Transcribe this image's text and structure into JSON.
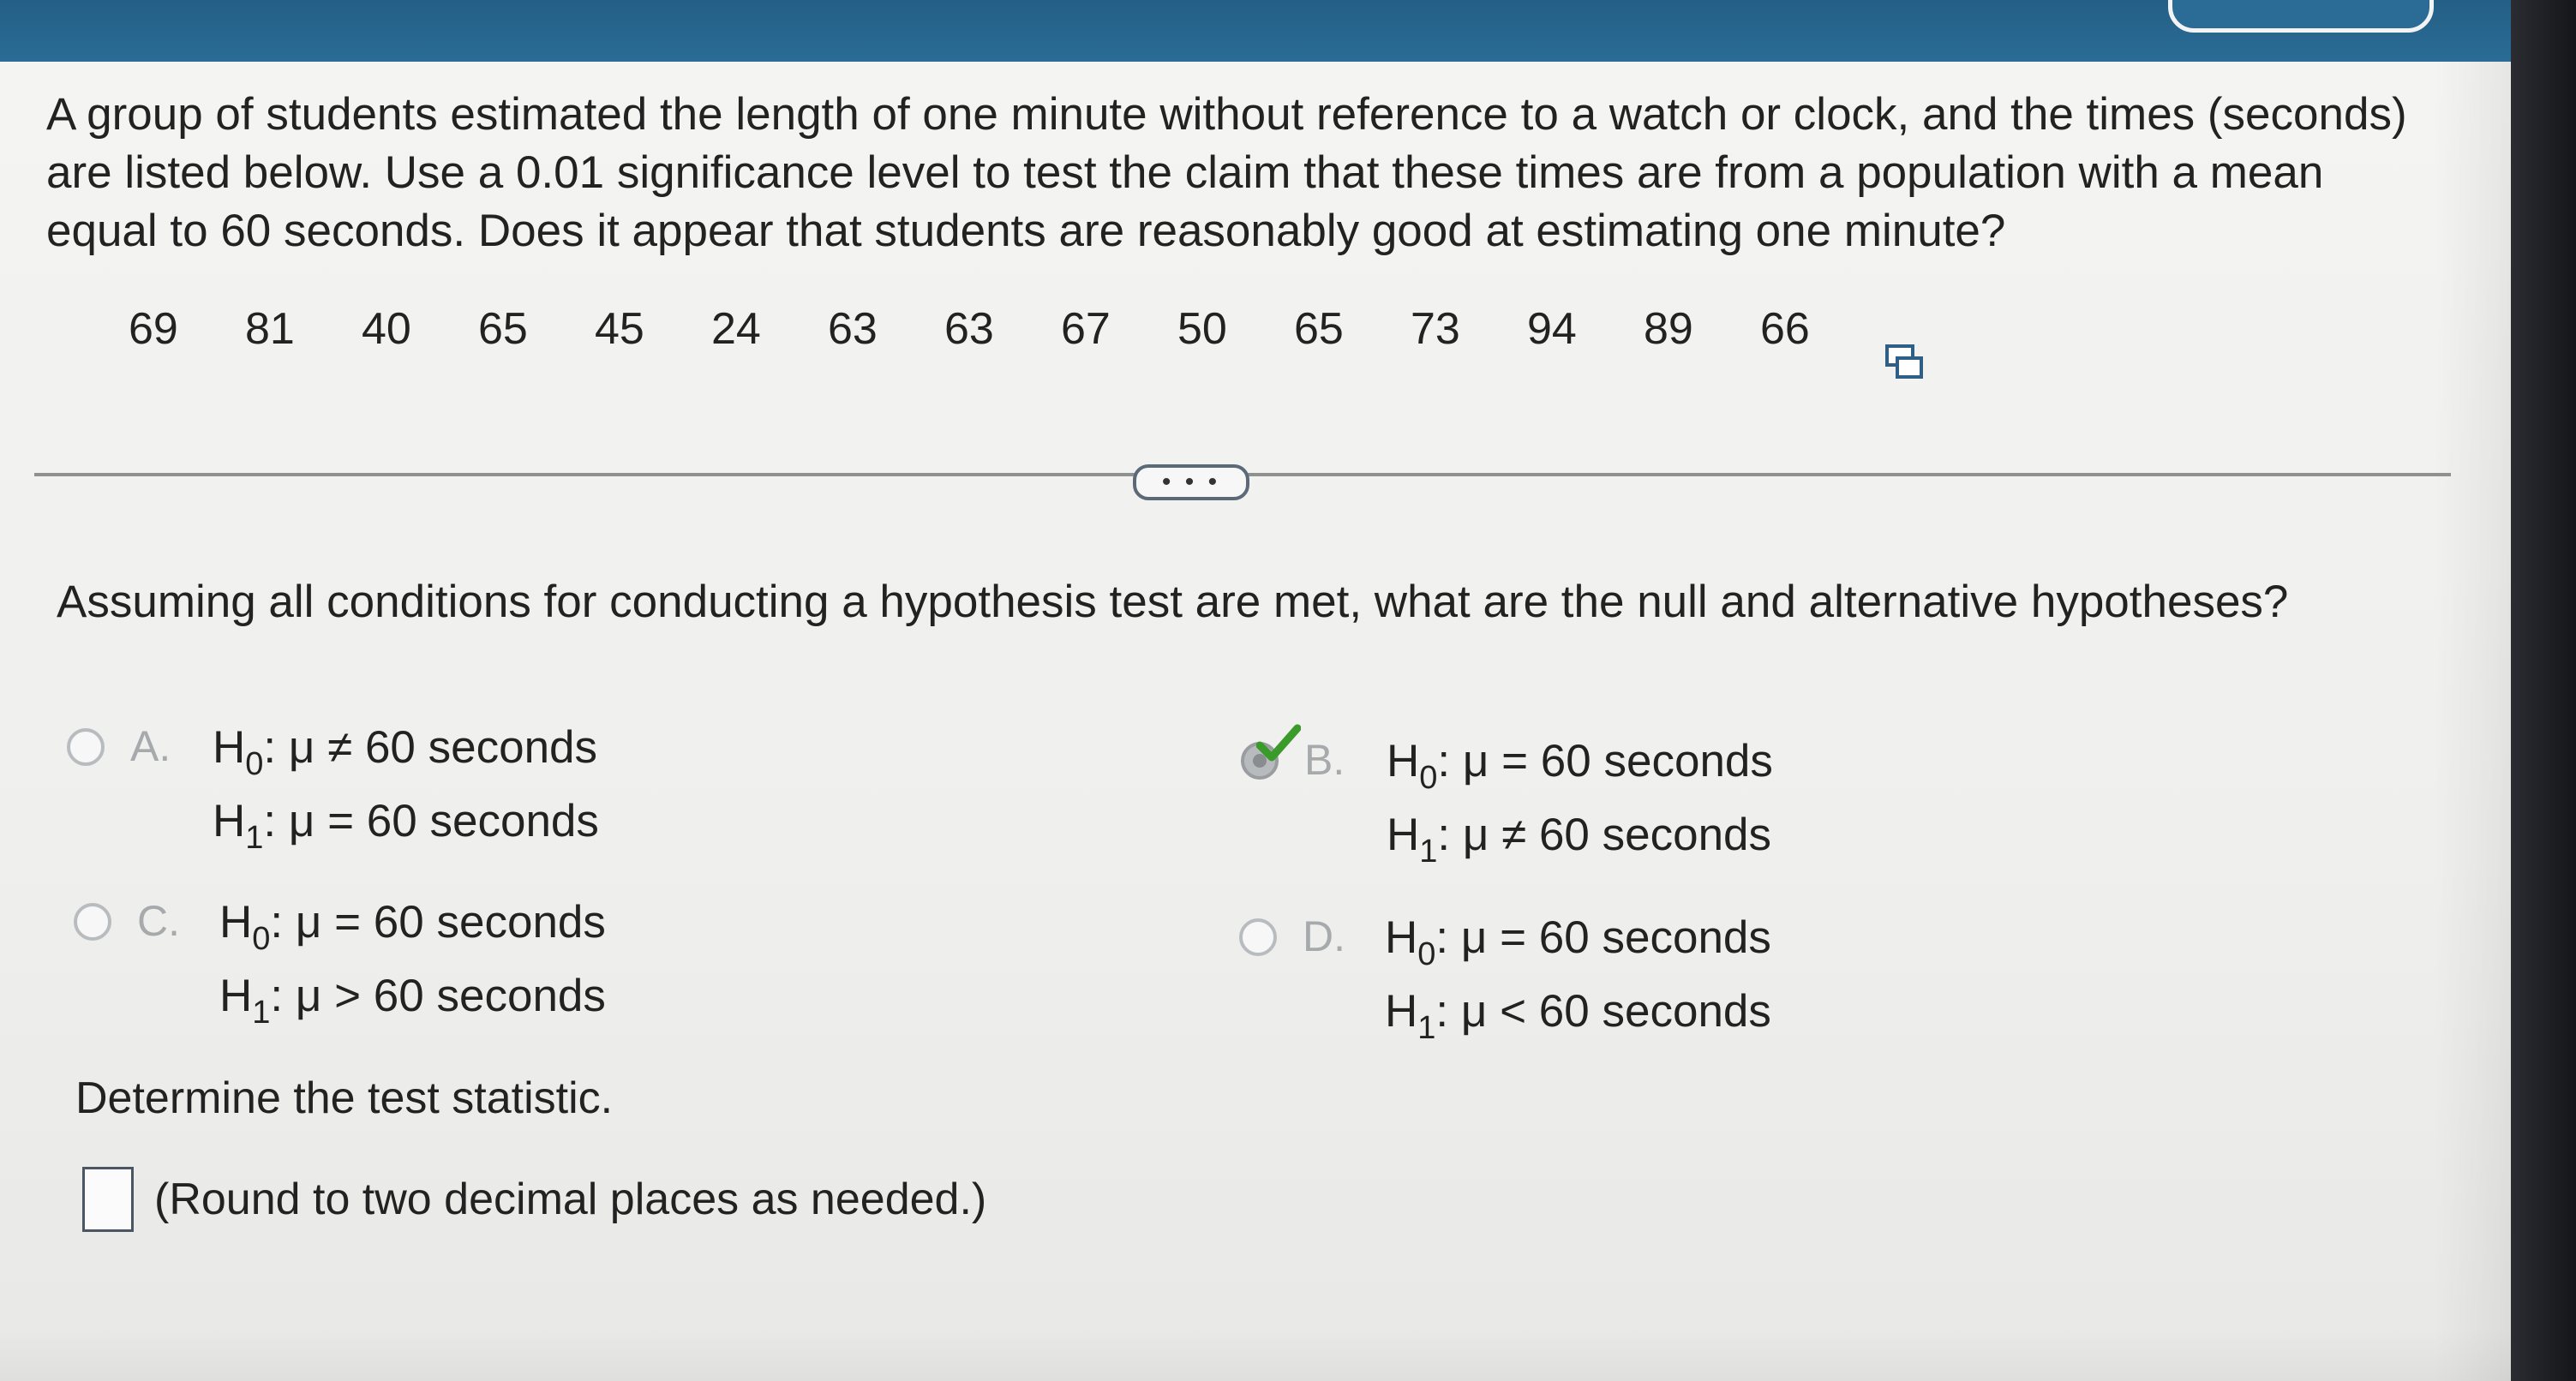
{
  "question": {
    "text": "A group of students estimated the length of one minute without reference to a watch or clock, and the times (seconds) are listed below. Use a 0.01 significance level to test the claim that these times are from a population with a mean equal to 60 seconds. Does it appear that students are reasonably good at estimating one minute?"
  },
  "data_values": [
    "69",
    "81",
    "40",
    "65",
    "45",
    "24",
    "63",
    "63",
    "67",
    "50",
    "65",
    "73",
    "94",
    "89",
    "66"
  ],
  "more_button": {
    "label": "• • •"
  },
  "hypothesis_question": "Assuming all conditions for conducting a hypothesis test are met, what are the null and alternative hypotheses?",
  "options": [
    {
      "letter": "A.",
      "h0_prefix": "H",
      "h0_sub": "0",
      "h0_rest": ": μ ≠ 60 seconds",
      "h1_prefix": "H",
      "h1_sub": "1",
      "h1_rest": ": μ = 60 seconds",
      "selected": false
    },
    {
      "letter": "B.",
      "h0_prefix": "H",
      "h0_sub": "0",
      "h0_rest": ": μ = 60 seconds",
      "h1_prefix": "H",
      "h1_sub": "1",
      "h1_rest": ": μ ≠ 60 seconds",
      "selected": true
    },
    {
      "letter": "C.",
      "h0_prefix": "H",
      "h0_sub": "0",
      "h0_rest": ": μ = 60 seconds",
      "h1_prefix": "H",
      "h1_sub": "1",
      "h1_rest": ": μ > 60 seconds",
      "selected": false
    },
    {
      "letter": "D.",
      "h0_prefix": "H",
      "h0_sub": "0",
      "h0_rest": ": μ = 60 seconds",
      "h1_prefix": "H",
      "h1_sub": "1",
      "h1_rest": ": μ < 60 seconds",
      "selected": false
    }
  ],
  "test_statistic": {
    "prompt": "Determine the test statistic.",
    "answer_value": "",
    "note": "(Round to two decimal places as needed.)"
  },
  "colors": {
    "header": "#2a6c96",
    "check": "#3a9a2a",
    "divider": "#8f9090"
  },
  "icons": {
    "copy": "copy-data-icon",
    "check": "checkmark-icon"
  }
}
